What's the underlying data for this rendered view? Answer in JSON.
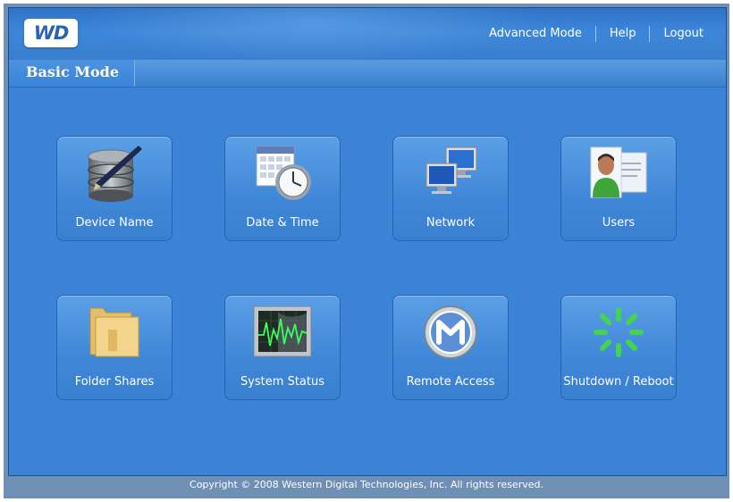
{
  "header": {
    "logo_text": "WD",
    "nav": {
      "advanced_mode": "Advanced Mode",
      "help": "Help",
      "logout": "Logout"
    }
  },
  "tab": {
    "active_label": "Basic Mode"
  },
  "tiles": [
    {
      "label": "Device Name",
      "icon": "database-pen-icon"
    },
    {
      "label": "Date & Time",
      "icon": "calendar-clock-icon"
    },
    {
      "label": "Network",
      "icon": "network-monitors-icon"
    },
    {
      "label": "Users",
      "icon": "user-card-icon"
    },
    {
      "label": "Folder Shares",
      "icon": "folder-icon"
    },
    {
      "label": "System Status",
      "icon": "monitor-graph-icon"
    },
    {
      "label": "Remote Access",
      "icon": "mionet-icon"
    },
    {
      "label": "Shutdown / Reboot",
      "icon": "spinner-icon"
    }
  ],
  "footer": {
    "copyright": "Copyright © 2008 Western Digital Technologies, Inc. All rights reserved."
  },
  "colors": {
    "background": "#3a83d6",
    "tile": "#4b90dd",
    "text": "#ffffff"
  }
}
